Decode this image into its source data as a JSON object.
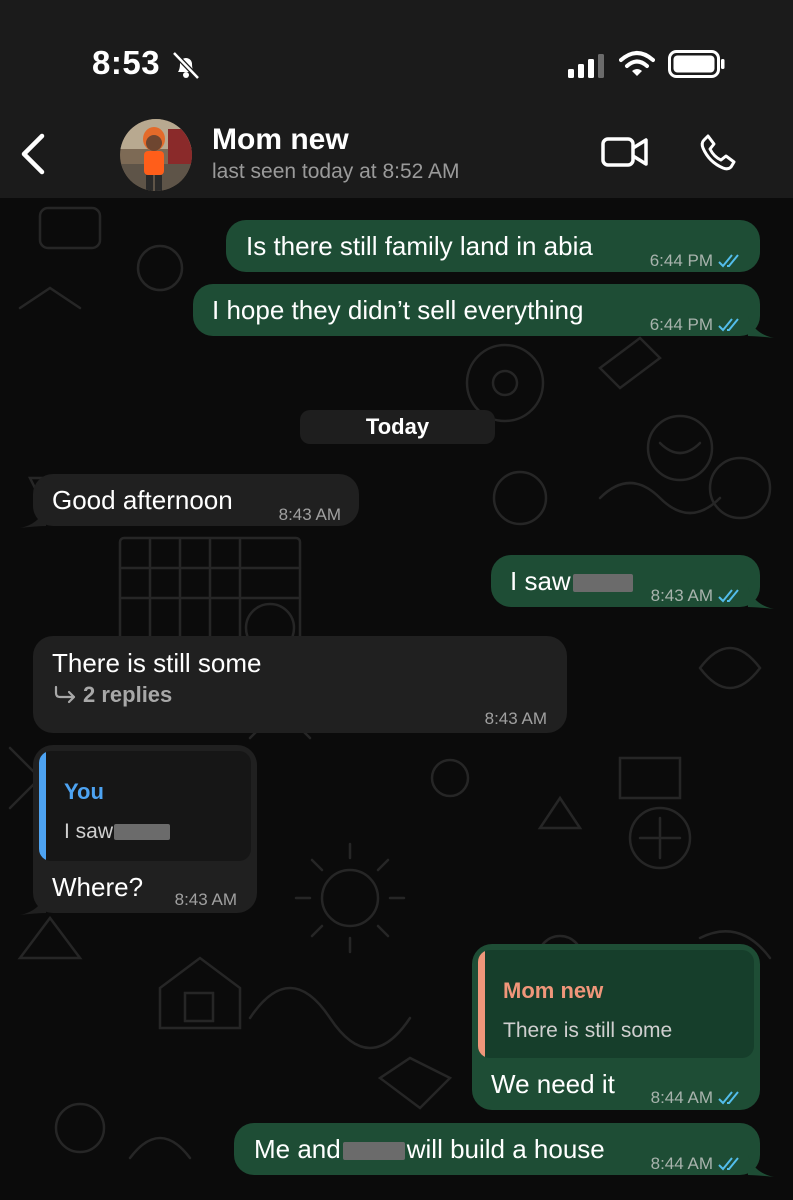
{
  "status_bar": {
    "time": "8:53"
  },
  "header": {
    "contact_name": "Mom new",
    "last_seen": "last seen today at 8:52 AM"
  },
  "date_separator": "Today",
  "messages": [
    {
      "direction": "out",
      "text": "Is there still family land in abia",
      "time": "6:44 PM",
      "read": true
    },
    {
      "direction": "out",
      "text": "I hope they didn’t sell everything",
      "time": "6:44 PM",
      "read": true
    },
    {
      "direction": "in",
      "text": "Good afternoon",
      "time": "8:43 AM"
    },
    {
      "direction": "out",
      "text_before": "I saw",
      "text_after": "",
      "time": "8:43 AM",
      "read": true
    },
    {
      "direction": "in",
      "text": "There is still some",
      "replies": "2 replies",
      "time": "8:43 AM"
    },
    {
      "direction": "in",
      "quote_author": "You",
      "quote_text": "I saw",
      "text": "Where?",
      "time": "8:43 AM"
    },
    {
      "direction": "out",
      "quote_author": "Mom new",
      "quote_text": "There is still some",
      "text": "We need it",
      "time": "8:44 AM",
      "read": true
    },
    {
      "direction": "out",
      "text_before": "Me and",
      "text_after": "will build a house",
      "time": "8:44 AM",
      "read": true
    }
  ],
  "colors": {
    "outgoing_bubble": "#1e4d35",
    "incoming_bubble": "#202020",
    "read_ticks": "#53bdeb",
    "quote_you": "#4da3f2",
    "quote_mom": "#f0967a"
  },
  "icons": {
    "back": "chevron-left-icon",
    "video": "video-camera-icon",
    "call": "phone-icon",
    "mute": "bell-slash-icon",
    "reply": "reply-arrow-icon"
  }
}
